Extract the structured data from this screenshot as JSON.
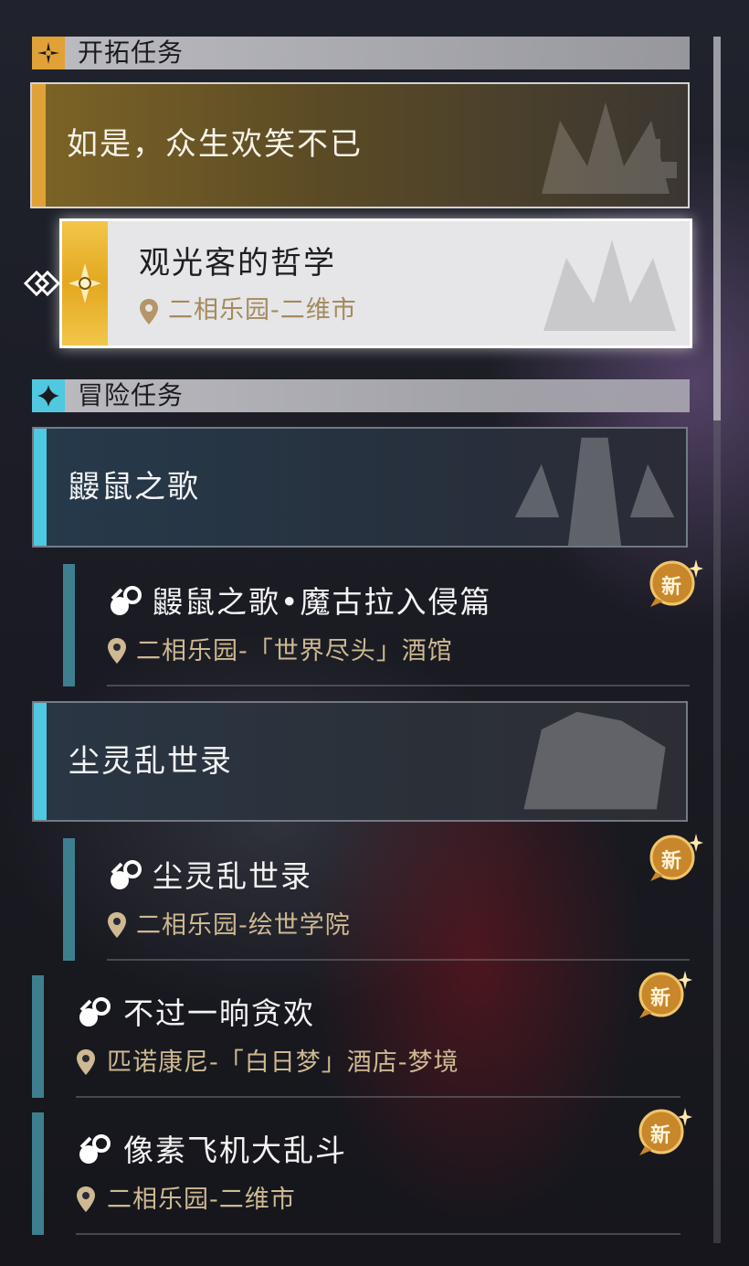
{
  "trailblaze": {
    "header": "开拓任务",
    "chapter_title": "如是，众生欢笑不已",
    "selected_quest": {
      "name": "观光客的哲学",
      "location": "二相乐园-二维市"
    }
  },
  "adventure": {
    "header": "冒险任务",
    "groups": [
      {
        "title": "鼹鼠之歌",
        "quests": [
          {
            "name": "鼹鼠之歌•魔古拉入侵篇",
            "location": "二相乐园-「世界尽头」酒馆",
            "badge": "新"
          }
        ]
      },
      {
        "title": "尘灵乱世录",
        "quests": [
          {
            "name": "尘灵乱世录",
            "location": "二相乐园-绘世学院",
            "badge": "新"
          }
        ]
      }
    ],
    "loose_quests": [
      {
        "name": "不过一晌贪欢",
        "location": "匹诺康尼-「白日梦」酒店-梦境",
        "badge": "新"
      },
      {
        "name": "像素飞机大乱斗",
        "location": "二相乐园-二维市",
        "badge": "新"
      }
    ]
  },
  "colors": {
    "trailblaze_accent": "#e0a236",
    "adventure_accent": "#4fc8e0",
    "quest_bar": "#3e7f8f",
    "location_text": "#cdb992",
    "new_badge": "#c8872a"
  },
  "icons": {
    "trailblaze_header": "trailblaze-star-icon",
    "adventure_header": "four-point-star-icon",
    "quest_type": "adventure-quest-icon",
    "location": "location-pin-icon",
    "tracking": "tracking-arrow-icon"
  }
}
